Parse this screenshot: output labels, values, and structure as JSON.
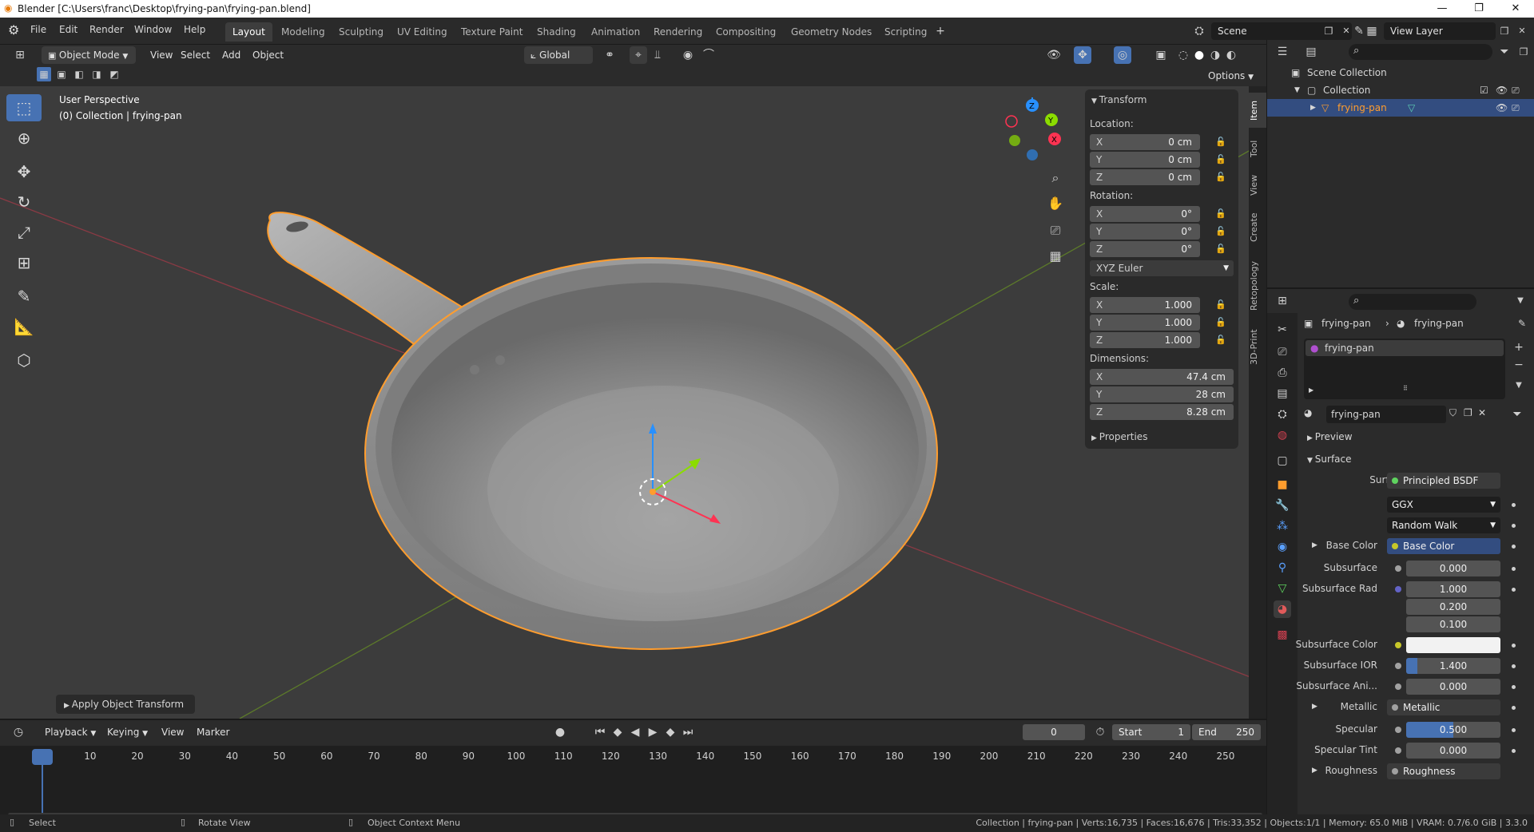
{
  "window": {
    "title": "Blender [C:\\Users\\franc\\Desktop\\frying-pan\\frying-pan.blend]"
  },
  "menu": [
    "File",
    "Edit",
    "Render",
    "Window",
    "Help"
  ],
  "workspaces": [
    "Layout",
    "Modeling",
    "Sculpting",
    "UV Editing",
    "Texture Paint",
    "Shading",
    "Animation",
    "Rendering",
    "Compositing",
    "Geometry Nodes",
    "Scripting"
  ],
  "active_workspace": "Layout",
  "scene": {
    "name": "Scene",
    "view_layer": "View Layer"
  },
  "viewport_header": {
    "mode": "Object Mode",
    "menus": [
      "View",
      "Select",
      "Add",
      "Object"
    ],
    "transform_orientation": "Global",
    "options": "Options"
  },
  "viewport": {
    "perspective_label": "User Perspective",
    "collection_label": "(0) Collection | frying-pan",
    "operator_panel": "Apply Object Transform"
  },
  "npanel": {
    "tabs": [
      "Item",
      "Tool",
      "View",
      "Create",
      "Retopology",
      "3D-Print"
    ],
    "transform_title": "Transform",
    "location_label": "Location:",
    "location": [
      {
        "axis": "X",
        "value": "0 cm"
      },
      {
        "axis": "Y",
        "value": "0 cm"
      },
      {
        "axis": "Z",
        "value": "0 cm"
      }
    ],
    "rotation_label": "Rotation:",
    "rotation": [
      {
        "axis": "X",
        "value": "0°"
      },
      {
        "axis": "Y",
        "value": "0°"
      },
      {
        "axis": "Z",
        "value": "0°"
      }
    ],
    "rotation_mode": "XYZ Euler",
    "scale_label": "Scale:",
    "scale": [
      {
        "axis": "X",
        "value": "1.000"
      },
      {
        "axis": "Y",
        "value": "1.000"
      },
      {
        "axis": "Z",
        "value": "1.000"
      }
    ],
    "dimensions_label": "Dimensions:",
    "dimensions": [
      {
        "axis": "X",
        "value": "47.4 cm"
      },
      {
        "axis": "Y",
        "value": "28 cm"
      },
      {
        "axis": "Z",
        "value": "8.28 cm"
      }
    ],
    "properties_label": "Properties"
  },
  "outliner": {
    "scene_collection": "Scene Collection",
    "collection": "Collection",
    "object": "frying-pan"
  },
  "properties": {
    "breadcrumb_object": "frying-pan",
    "breadcrumb_material": "frying-pan",
    "material_slot": "frying-pan",
    "material_name": "frying-pan",
    "preview_label": "Preview",
    "surface_section": "Surface",
    "surface_label": "Surface",
    "surface_value": "Principled BSDF",
    "distribution": "GGX",
    "subsurface_method": "Random Walk",
    "rows": [
      {
        "label": "Base Color",
        "value": "Base Color"
      },
      {
        "label": "Subsurface",
        "value": "0.000"
      },
      {
        "label": "Subsurface Rad",
        "value": "1.000"
      },
      {
        "label": "",
        "value": "0.200"
      },
      {
        "label": "",
        "value": "0.100"
      },
      {
        "label": "Subsurface Color",
        "value": ""
      },
      {
        "label": "Subsurface IOR",
        "value": "1.400"
      },
      {
        "label": "Subsurface Ani...",
        "value": "0.000"
      },
      {
        "label": "Metallic",
        "value": "Metallic"
      },
      {
        "label": "Specular",
        "value": "0.500"
      },
      {
        "label": "Specular Tint",
        "value": "0.000"
      },
      {
        "label": "Roughness",
        "value": "Roughness"
      }
    ]
  },
  "timeline": {
    "menus": [
      "Playback",
      "Keying",
      "View",
      "Marker"
    ],
    "current_frame": "0",
    "start_label": "Start",
    "start": "1",
    "end_label": "End",
    "end": "250",
    "frames": [
      "0",
      "10",
      "20",
      "30",
      "40",
      "50",
      "60",
      "70",
      "80",
      "90",
      "100",
      "110",
      "120",
      "130",
      "140",
      "150",
      "160",
      "170",
      "180",
      "190",
      "200",
      "210",
      "220",
      "230",
      "240",
      "250"
    ]
  },
  "statusbar": {
    "select": "Select",
    "rotate": "Rotate View",
    "context": "Object Context Menu",
    "stats": "Collection | frying-pan | Verts:16,735 | Faces:16,676 | Tris:33,352 | Objects:1/1 | Memory: 65.0 MiB | VRAM: 0.7/6.0 GiB | 3.3.0"
  },
  "colors": {
    "accent": "#4772b3",
    "selection": "#ff9d2e",
    "x_axis": "#ff3352",
    "y_axis": "#8bdc00",
    "z_axis": "#2890ff"
  }
}
